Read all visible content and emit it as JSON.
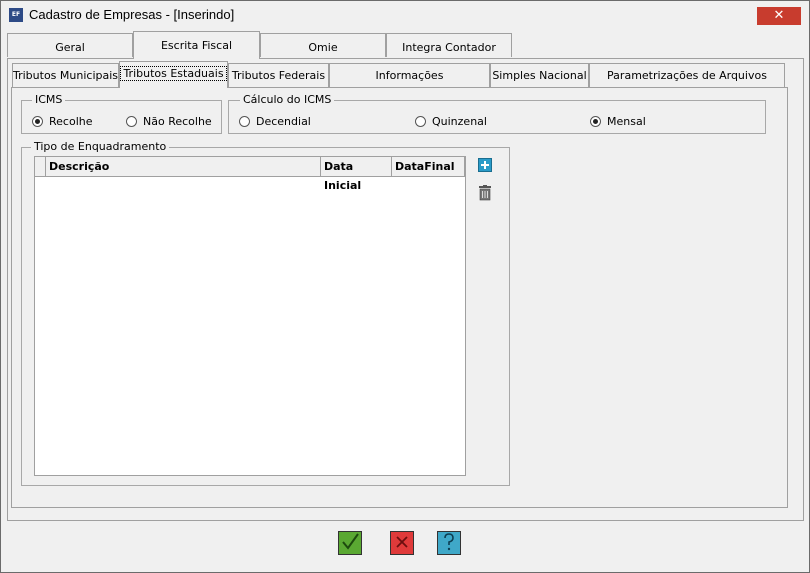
{
  "window": {
    "title": "Cadastro de Empresas - [Inserindo]",
    "icon_text": "EF",
    "close_symbol": "✕"
  },
  "tabs_main": [
    {
      "label": "Geral"
    },
    {
      "label": "Escrita Fiscal",
      "active": true
    },
    {
      "label": "Omie"
    },
    {
      "label": "Integra Contador"
    }
  ],
  "tabs_sub": [
    {
      "label": "Tributos Municipais"
    },
    {
      "label": "Tributos Estaduais",
      "active": true
    },
    {
      "label": "Tributos Federais"
    },
    {
      "label": "Informações Complementares"
    },
    {
      "label": "Simples Nacional"
    },
    {
      "label": "Parametrizações de Arquivos Digitais"
    }
  ],
  "icms": {
    "label": "ICMS",
    "options": [
      {
        "label": "Recolhe",
        "checked": true
      },
      {
        "label": "Não Recolhe",
        "checked": false
      }
    ]
  },
  "calculo": {
    "label": "Cálculo do ICMS",
    "options": [
      {
        "label": "Decendial",
        "checked": false
      },
      {
        "label": "Quinzenal",
        "checked": false
      },
      {
        "label": "Mensal",
        "checked": true
      }
    ]
  },
  "enquadramento": {
    "label": "Tipo de Enquadramento",
    "columns": [
      "Descrição",
      "Data Inicial",
      "DataFinal"
    ],
    "rows": []
  },
  "icons": {
    "add": "add-icon",
    "delete": "trash-icon",
    "confirm": "check-icon",
    "cancel": "x-icon",
    "help": "question-icon"
  },
  "colors": {
    "confirm": "#5aa832",
    "cancel": "#e03a3a",
    "help": "#3fa8c8",
    "close": "#c83c2e",
    "add": "#2a9bc8"
  }
}
